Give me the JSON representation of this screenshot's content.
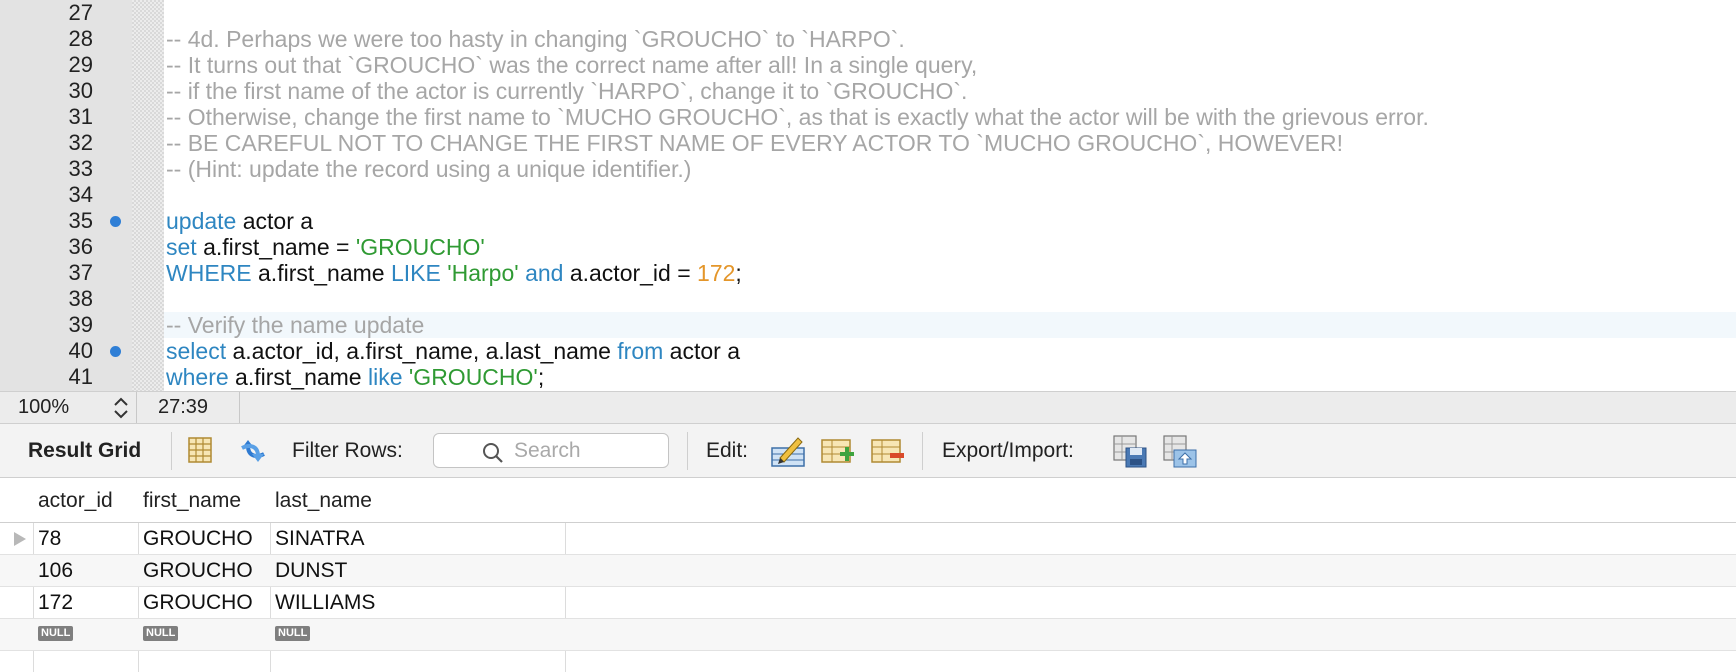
{
  "editor": {
    "lines": [
      {
        "num": "27",
        "segments": []
      },
      {
        "num": "28",
        "segments": [
          {
            "t": "-- 4d. Perhaps we were too hasty in changing `GROUCHO` to `HARPO`.",
            "c": "comment"
          }
        ]
      },
      {
        "num": "29",
        "segments": [
          {
            "t": "-- It turns out that `GROUCHO` was the correct name after all! In a single query,",
            "c": "comment"
          }
        ]
      },
      {
        "num": "30",
        "segments": [
          {
            "t": "-- if the first name of the actor is currently `HARPO`, change it to `GROUCHO`.",
            "c": "comment"
          }
        ]
      },
      {
        "num": "31",
        "segments": [
          {
            "t": "-- Otherwise, change the first name to `MUCHO GROUCHO`, as that is exactly what the actor will be with the grievous error.",
            "c": "comment"
          }
        ]
      },
      {
        "num": "32",
        "segments": [
          {
            "t": "-- BE CAREFUL NOT TO CHANGE THE FIRST NAME OF EVERY ACTOR TO `MUCHO GROUCHO`, HOWEVER!",
            "c": "comment"
          }
        ]
      },
      {
        "num": "33",
        "segments": [
          {
            "t": "-- (Hint: update the record using a unique identifier.)",
            "c": "comment"
          }
        ]
      },
      {
        "num": "34",
        "segments": []
      },
      {
        "num": "35",
        "marker": true,
        "segments": [
          {
            "t": "update",
            "c": "kw"
          },
          {
            "t": " actor a",
            "c": ""
          }
        ]
      },
      {
        "num": "36",
        "segments": [
          {
            "t": "set",
            "c": "kw"
          },
          {
            "t": " a.first_name = ",
            "c": ""
          },
          {
            "t": "'GROUCHO'",
            "c": "str"
          }
        ]
      },
      {
        "num": "37",
        "segments": [
          {
            "t": "WHERE",
            "c": "kw"
          },
          {
            "t": " a.first_name ",
            "c": ""
          },
          {
            "t": "LIKE",
            "c": "kw"
          },
          {
            "t": " ",
            "c": ""
          },
          {
            "t": "'Harpo'",
            "c": "str"
          },
          {
            "t": " ",
            "c": ""
          },
          {
            "t": "and",
            "c": "kw"
          },
          {
            "t": " a.actor_id = ",
            "c": ""
          },
          {
            "t": "172",
            "c": "num"
          },
          {
            "t": ";",
            "c": ""
          }
        ]
      },
      {
        "num": "38",
        "segments": []
      },
      {
        "num": "39",
        "current": true,
        "segments": [
          {
            "t": "-- Verify the name update",
            "c": "comment"
          }
        ]
      },
      {
        "num": "40",
        "marker": true,
        "segments": [
          {
            "t": "select",
            "c": "kw"
          },
          {
            "t": " a.actor_id, a.first_name, a.last_name ",
            "c": ""
          },
          {
            "t": "from",
            "c": "kw"
          },
          {
            "t": " actor a",
            "c": ""
          }
        ]
      },
      {
        "num": "41",
        "segments": [
          {
            "t": "where",
            "c": "kw"
          },
          {
            "t": " a.first_name ",
            "c": ""
          },
          {
            "t": "like",
            "c": "kw"
          },
          {
            "t": " ",
            "c": ""
          },
          {
            "t": "'GROUCHO'",
            "c": "str"
          },
          {
            "t": ";",
            "c": ""
          }
        ]
      }
    ]
  },
  "status": {
    "zoom": "100%",
    "cursor": "27:39"
  },
  "toolbar": {
    "result_grid": "Result Grid",
    "filter_rows": "Filter Rows:",
    "search_placeholder": "Search",
    "edit": "Edit:",
    "export_import": "Export/Import:"
  },
  "grid": {
    "columns": [
      "actor_id",
      "first_name",
      "last_name"
    ],
    "rows": [
      [
        "78",
        "GROUCHO",
        "SINATRA"
      ],
      [
        "106",
        "GROUCHO",
        "DUNST"
      ],
      [
        "172",
        "GROUCHO",
        "WILLIAMS"
      ]
    ],
    "null_label": "NULL"
  },
  "colors": {
    "keyword": "#2e86c1",
    "string": "#2f9a33",
    "number": "#e4962a",
    "comment": "#a6a6a6",
    "marker": "#2f7fd6"
  }
}
